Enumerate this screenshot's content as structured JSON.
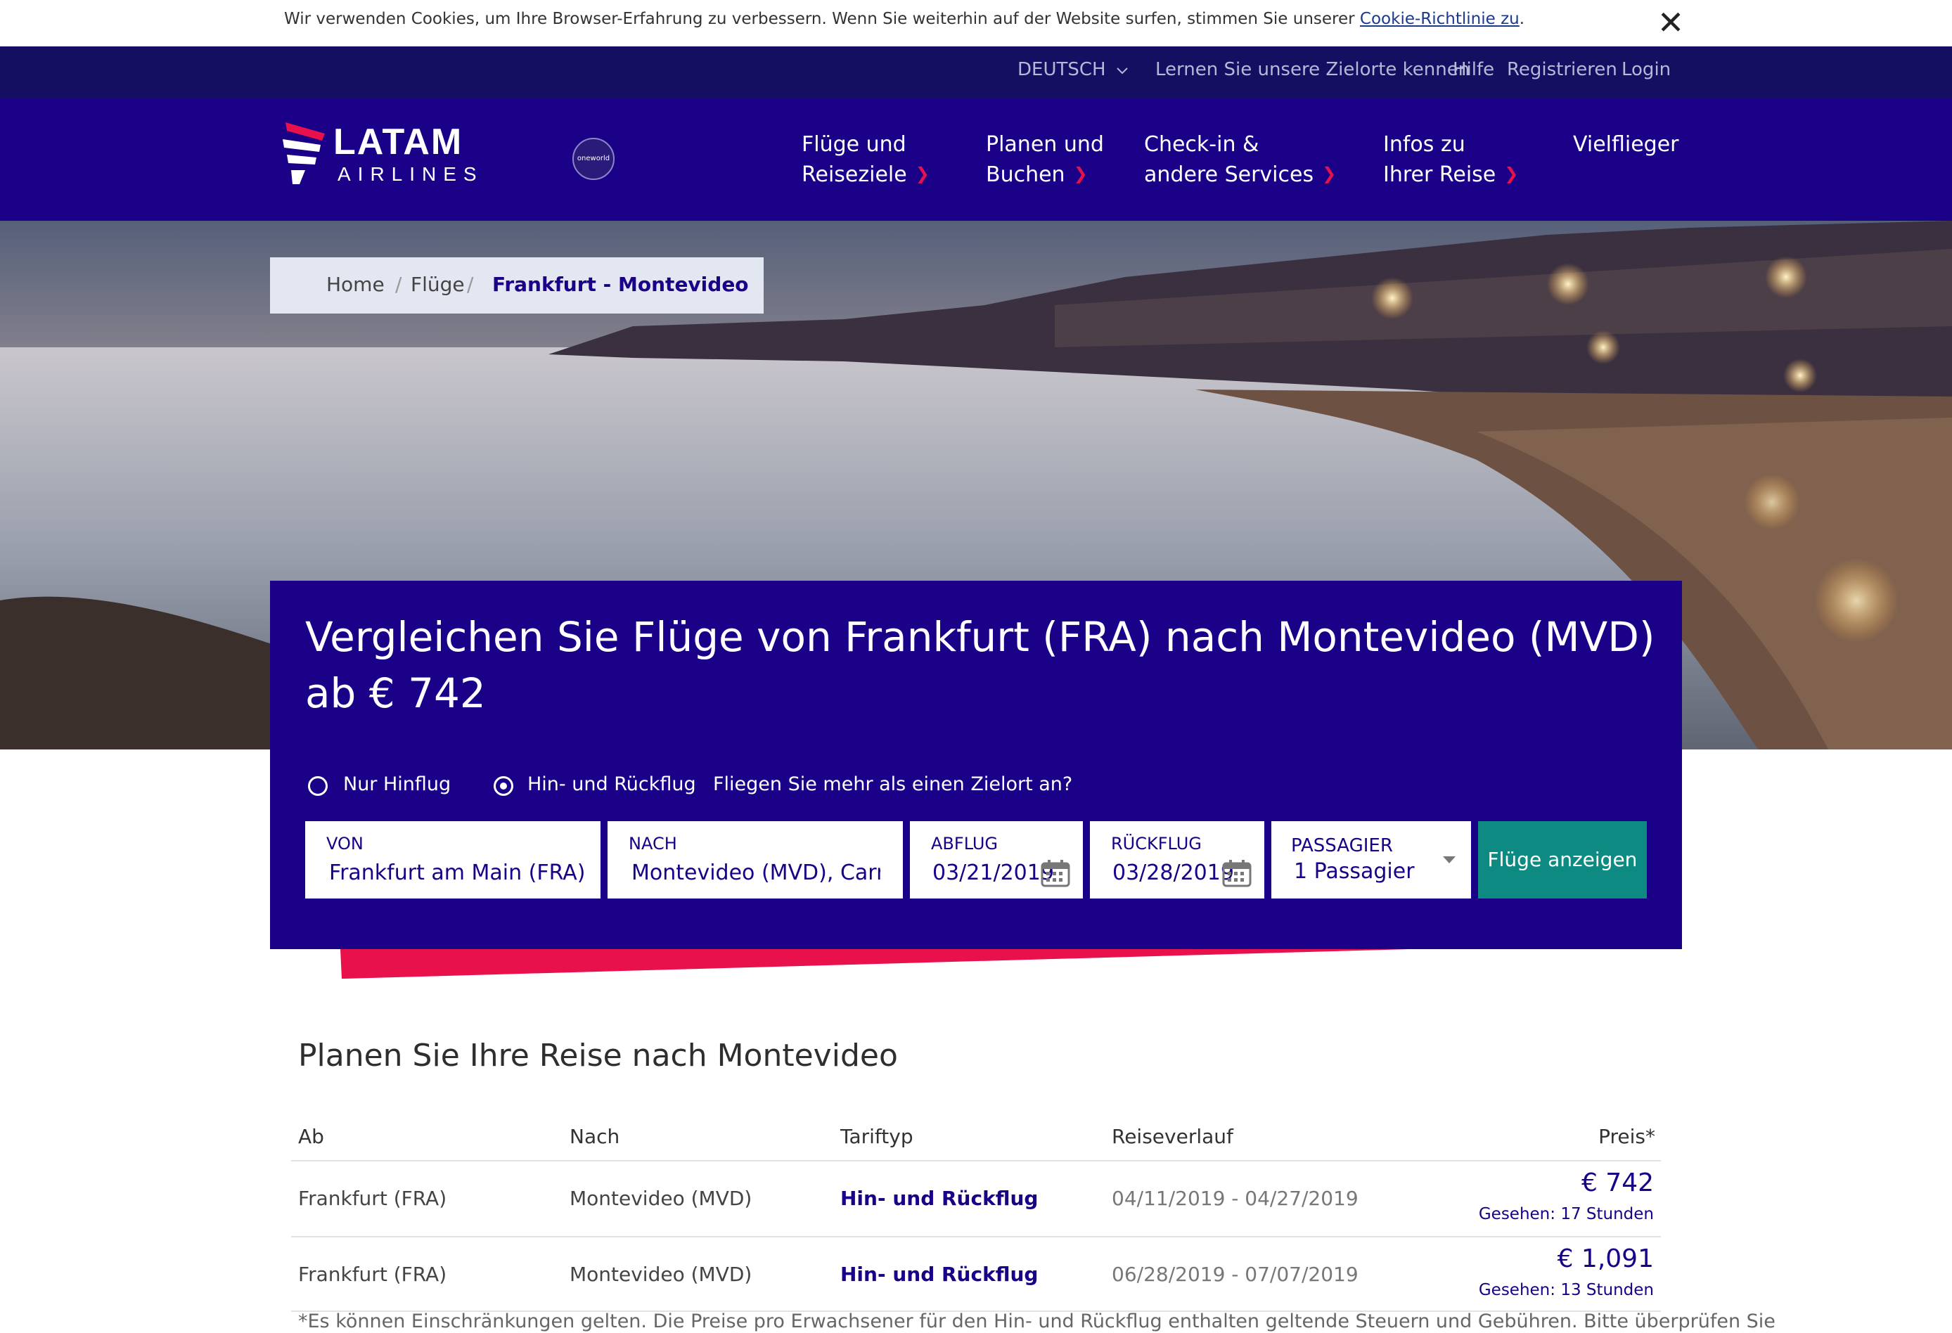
{
  "cookie_bar": {
    "text": "Wir verwenden Cookies, um Ihre Browser-Erfahrung zu verbessern. Wenn Sie weiterhin auf der Website surfen, stimmen Sie unserer ",
    "link": "Cookie-Richtlinie zu",
    "suffix": ".",
    "close": "✕"
  },
  "utility_nav": {
    "language": "DEUTSCH",
    "destinations": "Lernen Sie unsere Zielorte kennen",
    "help": "Hilfe",
    "register": "Registrieren",
    "login": "Login"
  },
  "brand": {
    "name": "LATAM",
    "sub": "AIRLINES",
    "alliance": "oneworld"
  },
  "main_nav": [
    {
      "line1": "Flüge und",
      "line2": "Reiseziele"
    },
    {
      "line1": "Planen und",
      "line2": "Buchen"
    },
    {
      "line1": "Check-in &",
      "line2": "andere Services"
    },
    {
      "line1": "Infos zu",
      "line2": "Ihrer Reise"
    },
    {
      "line1": "Vielflieger",
      "line2": ""
    }
  ],
  "breadcrumb": {
    "home": "Home",
    "sep": "/",
    "flights": "Flüge",
    "current": "Frankfurt - Montevideo"
  },
  "search": {
    "headline": "Vergleichen Sie Flüge von Frankfurt (FRA) nach Montevideo (MVD) ab € 742",
    "trip_one_way": "Nur Hinflug",
    "trip_round": "Hin- und Rückflug",
    "multi_city": "Fliegen Sie mehr als einen Zielort an?",
    "from_label": "VON",
    "from_value": "Frankfurt am Main (FRA), F",
    "to_label": "NACH",
    "to_value": "Montevideo (MVD), Carrasc",
    "depart_label": "ABFLUG",
    "depart_value": "03/21/2019",
    "return_label": "RÜCKFLUG",
    "return_value": "03/28/2019",
    "pax_label": "PASSAGIER",
    "pax_value": "1 Passagier",
    "button": "Flüge anzeigen"
  },
  "colors": {
    "brand_navy": "#1b0088",
    "accent_red": "#e8114b",
    "button_teal": "#0d8b83"
  },
  "trip_table": {
    "title": "Planen Sie Ihre Reise nach Montevideo",
    "headers": [
      "Ab",
      "Nach",
      "Tariftyp",
      "Reiseverlauf",
      "Preis*"
    ],
    "rows": [
      {
        "from": "Frankfurt (FRA)",
        "to": "Montevideo (MVD)",
        "fare": "Hin- und Rückflug",
        "dates": "04/11/2019 - 04/27/2019",
        "price": "€ 742",
        "seen": "Gesehen: 17 Stunden"
      },
      {
        "from": "Frankfurt (FRA)",
        "to": "Montevideo (MVD)",
        "fare": "Hin- und Rückflug",
        "dates": "06/28/2019 - 07/07/2019",
        "price": "€ 1,091",
        "seen": "Gesehen: 13 Stunden"
      }
    ],
    "footnote": "*Es können Einschränkungen gelten. Die Preise pro Erwachsener für den Hin- und Rückflug enthalten geltende Steuern und Gebühren. Bitte überprüfen Sie"
  }
}
